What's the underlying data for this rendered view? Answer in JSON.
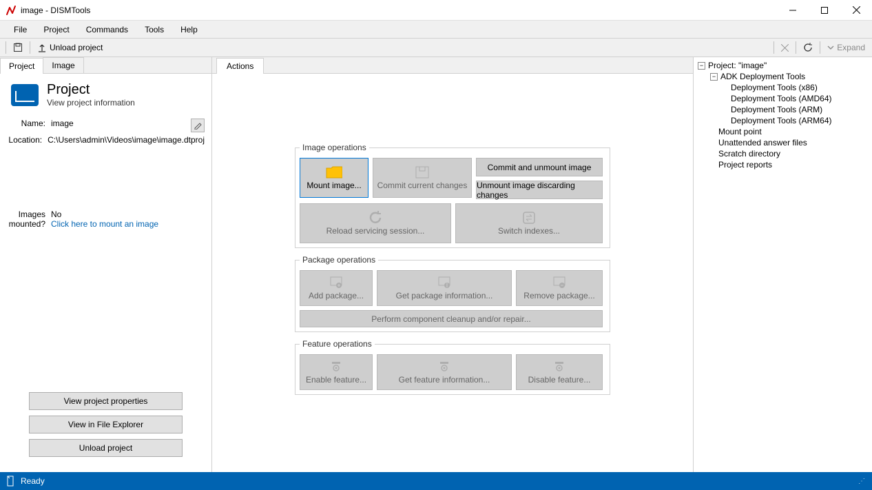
{
  "window": {
    "title": "image - DISMTools"
  },
  "menu": [
    "File",
    "Project",
    "Commands",
    "Tools",
    "Help"
  ],
  "toolbar": {
    "save": "",
    "unload": "Unload project",
    "expand": "Expand"
  },
  "leftTabs": [
    "Project",
    "Image"
  ],
  "project": {
    "title": "Project",
    "subtitle": "View project information",
    "fields": {
      "name_label": "Name:",
      "name_value": "image",
      "location_label": "Location:",
      "location_value": "C:\\Users\\admin\\Videos\\image\\image.dtproj",
      "mounted_label1": "Images",
      "mounted_label2": "mounted?",
      "mounted_value": "No",
      "mount_link": "Click here to mount an image"
    },
    "buttons": {
      "view_props": "View project properties",
      "view_explorer": "View in File Explorer",
      "unload": "Unload project"
    }
  },
  "centerTab": "Actions",
  "imageOps": {
    "legend": "Image operations",
    "mount": "Mount image...",
    "commit": "Commit current changes",
    "commit_unmount": "Commit and unmount image",
    "unmount_discard": "Unmount image discarding changes",
    "reload": "Reload servicing session...",
    "switch": "Switch indexes..."
  },
  "packageOps": {
    "legend": "Package operations",
    "add": "Add package...",
    "get": "Get package information...",
    "remove": "Remove package...",
    "cleanup": "Perform component cleanup and/or repair..."
  },
  "featureOps": {
    "legend": "Feature operations",
    "enable": "Enable feature...",
    "get": "Get feature information...",
    "disable": "Disable feature..."
  },
  "tree": {
    "root": "Project: \"image\"",
    "adk": "ADK Deployment Tools",
    "adk_items": [
      "Deployment Tools (x86)",
      "Deployment Tools (AMD64)",
      "Deployment Tools (ARM)",
      "Deployment Tools (ARM64)"
    ],
    "items": [
      "Mount point",
      "Unattended answer files",
      "Scratch directory",
      "Project reports"
    ]
  },
  "status": "Ready"
}
